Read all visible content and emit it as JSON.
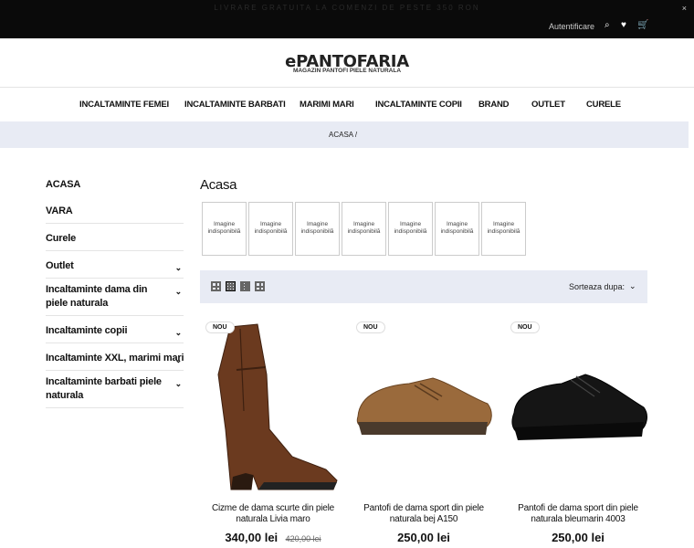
{
  "topbar": {
    "promo": "LIVRARE GRATUITA LA COMENZI DE PESTE 350 RON",
    "close": "×",
    "auth": "Autentificare",
    "search_glyph": "⌕",
    "heart_glyph": "♥",
    "cart_glyph": "🛒"
  },
  "brand": {
    "logo": "ePANTOFARIA",
    "tagline": "MAGAZIN PANTOFI PIELE NATURALA"
  },
  "nav": [
    "INCALTAMINTE FEMEI",
    "INCALTAMINTE BARBATI",
    "MARIMI MARI",
    "INCALTAMINTE COPII",
    "BRAND",
    "OUTLET",
    "CURELE"
  ],
  "breadcrumb": "ACASA  /",
  "sidebar": [
    {
      "label": "ACASA",
      "chev": ""
    },
    {
      "label": "VARA",
      "chev": ""
    },
    {
      "label": "Curele",
      "chev": ""
    },
    {
      "label": "Outlet",
      "chev": "⌄"
    },
    {
      "label": "Incaltaminte dama din piele naturala",
      "chev": "⌄"
    },
    {
      "label": "Incaltaminte copii",
      "chev": "⌄"
    },
    {
      "label": "Incaltaminte XXL, marimi mari",
      "chev": "⌄"
    },
    {
      "label": "Incaltaminte barbati piele naturala",
      "chev": "⌄"
    }
  ],
  "page_title": "Acasa",
  "thumbs": [
    "Imagine indisponibilă",
    "Imagine indisponibilă",
    "Imagine indisponibilă",
    "Imagine indisponibilă",
    "Imagine indisponibilă",
    "Imagine indisponibilă",
    "Imagine indisponibilă"
  ],
  "toolbar": {
    "sort_label": "Sorteaza dupa:",
    "sort_chev": "⌄"
  },
  "products": [
    {
      "badge": "NOU",
      "name": "Cizme de dama scurte din piele naturala Livia maro",
      "price": "340,00 lei",
      "old_price": "420,00 lei",
      "color": "#6b3a1f"
    },
    {
      "badge": "NOU",
      "name": "Pantofi de dama sport din piele naturala bej A150",
      "price": "250,00 lei",
      "old_price": "",
      "color": "#9a6a3c"
    },
    {
      "badge": "NOU",
      "name": "Pantofi de dama sport din piele naturala bleumarin 4003",
      "price": "250,00 lei",
      "old_price": "",
      "color": "#151515"
    }
  ]
}
